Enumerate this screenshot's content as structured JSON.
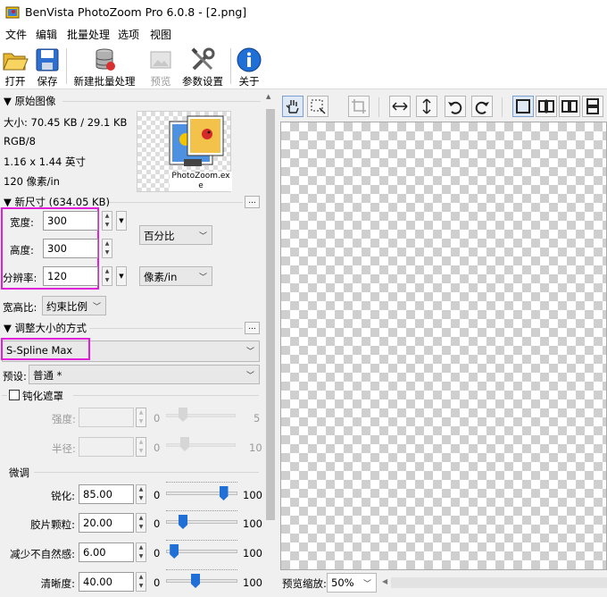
{
  "window": {
    "title": "BenVista PhotoZoom Pro 6.0.8 - [2.png]"
  },
  "menu": [
    "文件",
    "编辑",
    "批量处理",
    "选项",
    "视图"
  ],
  "toolbar": {
    "open": "打开",
    "save": "保存",
    "new_batch": "新建批量处理",
    "preview": "预览",
    "settings": "参数设置",
    "about": "关于"
  },
  "original": {
    "header": "▼ 原始图像",
    "size": "大小: 70.45 KB / 29.1 KB",
    "mode": "RGB/8",
    "dims": "1.16 x 1.44 英寸",
    "res": "120 像素/in",
    "thumb_label": "PhotoZoom.exe"
  },
  "newsize": {
    "header": "▼ 新尺寸 (634.05 KB)",
    "more": "...",
    "width_label": "宽度:",
    "width": "300",
    "height_label": "高度:",
    "height": "300",
    "res_label": "分辨率:",
    "res": "120",
    "unit_pct": "百分比",
    "unit_res": "像素/in",
    "aspect_label": "宽高比:",
    "aspect": "约束比例"
  },
  "method": {
    "header": "▼ 调整大小的方式",
    "more": "...",
    "algo": "S-Spline Max",
    "preset_label": "预设:",
    "preset": "普通 *"
  },
  "unsharp": {
    "label": "钝化遮罩",
    "checked": false,
    "strength_label": "强度:",
    "strength_min": "0",
    "strength_max": "5",
    "radius_label": "半径:",
    "radius_min": "0",
    "radius_max": "10"
  },
  "finetune": {
    "label": "微调",
    "rows": [
      {
        "label": "锐化:",
        "value": "85.00",
        "min": "0",
        "max": "100",
        "level": 0.85
      },
      {
        "label": "胶片颗粒:",
        "value": "20.00",
        "min": "0",
        "max": "100",
        "level": 0.2
      },
      {
        "label": "减少不自然感:",
        "value": "6.00",
        "min": "0",
        "max": "100",
        "level": 0.06
      },
      {
        "label": "清晰度:",
        "value": "40.00",
        "min": "0",
        "max": "100",
        "level": 0.4
      }
    ]
  },
  "preview": {
    "zoom_label": "预览缩放:",
    "zoom": "50%"
  },
  "colors": {
    "highlight": "#e020d8",
    "accent": "#1f6fd6"
  }
}
